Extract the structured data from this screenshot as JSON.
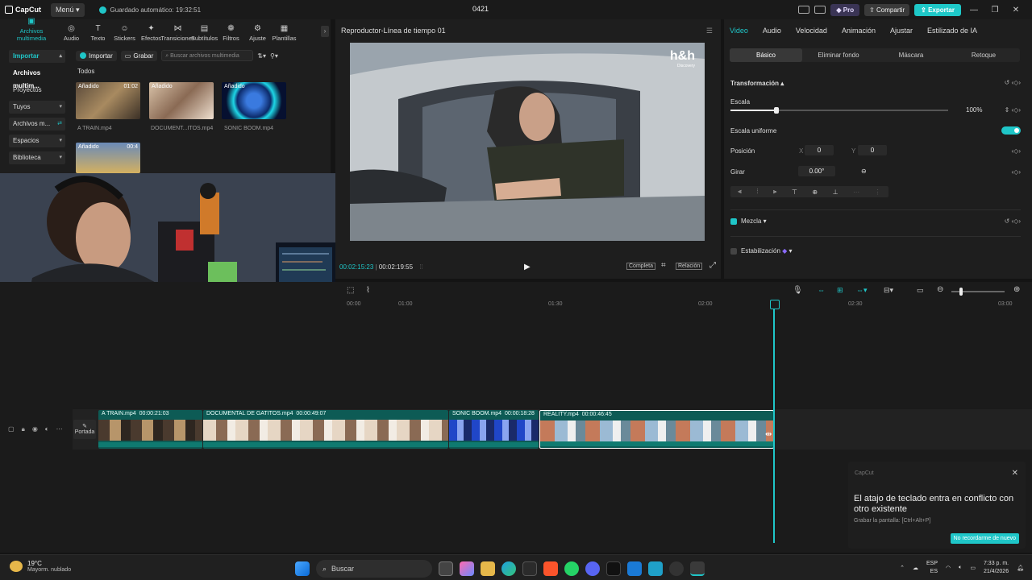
{
  "titlebar": {
    "app_name": "CapCut",
    "menu_label": "Menú",
    "autosave_text": "Guardado automático: 19:32:51",
    "project_name": "0421",
    "pro_label": "Pro",
    "share_label": "Compartir",
    "export_label": "Exportar"
  },
  "toolbar": {
    "items": [
      {
        "label": "Archivos multimedia",
        "icon": "media-icon"
      },
      {
        "label": "Audio",
        "icon": "audio-icon"
      },
      {
        "label": "Texto",
        "icon": "text-icon"
      },
      {
        "label": "Stickers",
        "icon": "sticker-icon"
      },
      {
        "label": "Efectos",
        "icon": "effects-icon"
      },
      {
        "label": "Transiciones",
        "icon": "transitions-icon"
      },
      {
        "label": "Subtítulos",
        "icon": "subtitles-icon"
      },
      {
        "label": "Filtros",
        "icon": "filters-icon"
      },
      {
        "label": "Ajuste",
        "icon": "adjust-icon"
      },
      {
        "label": "Plantillas",
        "icon": "templates-icon"
      }
    ]
  },
  "sidebar": {
    "items": [
      {
        "label": "Importar"
      },
      {
        "label": "Archivos multim..."
      },
      {
        "label": "Proyectos secun..."
      },
      {
        "label": "Tuyos"
      },
      {
        "label": "Archivos m..."
      },
      {
        "label": "Espacios"
      },
      {
        "label": "Biblioteca"
      }
    ]
  },
  "media": {
    "import_label": "Importar",
    "record_label": "Grabar",
    "search_placeholder": "Buscar archivos multimedia",
    "section_label": "Todos",
    "items": [
      {
        "badge": "Añadido",
        "duration": "01:02",
        "name": "A TRAIN.mp4"
      },
      {
        "badge": "Añadido",
        "duration": "",
        "name": "DOCUMENT...ITOS.mp4"
      },
      {
        "badge": "Añadido",
        "duration": "",
        "name": "SONIC BOOM.mp4"
      },
      {
        "badge": "Añadido",
        "duration": "00:4",
        "name": ""
      }
    ]
  },
  "player": {
    "title": "Reproductor-Línea de tiempo 01",
    "watermark": "h&h",
    "watermark_sub": "Discovery",
    "current_time": "00:02:15:23",
    "total_time": "00:02:19:55",
    "full_label": "Completa",
    "ratio_label": "Relación"
  },
  "inspector": {
    "tabs": [
      "Video",
      "Audio",
      "Velocidad",
      "Animación",
      "Ajustar",
      "Estilizado de IA"
    ],
    "subtabs": [
      "Básico",
      "Eliminar fondo",
      "Máscara",
      "Retoque"
    ],
    "transform_label": "Transformación",
    "scale_label": "Escala",
    "scale_value": "100%",
    "uniform_scale_label": "Escala uniforme",
    "position_label": "Posición",
    "pos_x_label": "X",
    "pos_x": "0",
    "pos_y_label": "Y",
    "pos_y": "0",
    "rotate_label": "Girar",
    "rotate_value": "0.00°",
    "blend_label": "Mezcla",
    "stabilize_label": "Estabilización"
  },
  "timeline": {
    "ruler": [
      "00:00",
      "01:00",
      "01:30",
      "02:00",
      "02:30",
      "03:00"
    ],
    "cover_label": "Portada",
    "clips": [
      {
        "name": "A TRAIN.mp4",
        "duration": "00:00:21:03"
      },
      {
        "name": "DOCUMENTAL DE GATITOS.mp4",
        "duration": "00:00:49:07"
      },
      {
        "name": "SONIC BOOM.mp4",
        "duration": "00:00:18:28"
      },
      {
        "name": "REALITY.mp4",
        "duration": "00:00:46:45"
      }
    ]
  },
  "toast": {
    "app": "CapCut",
    "message": "El atajo de teclado entra en conflicto con otro existente",
    "detail": "Grabar la pantalla: [Ctrl+Alt+P]",
    "button": "No recordarme de nuevo"
  },
  "taskbar": {
    "temp": "19°C",
    "weather": "Mayorm. nublado",
    "search_label": "Buscar",
    "lang1": "ESP",
    "lang2": "ES",
    "time": "7:33 p. m.",
    "date": "21/4/2026"
  }
}
